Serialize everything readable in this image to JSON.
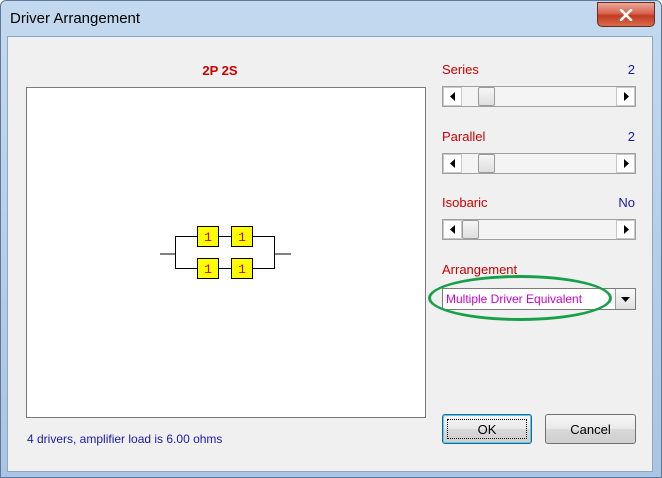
{
  "window": {
    "title": "Driver Arrangement"
  },
  "diagram": {
    "title": "2P 2S",
    "driver_label": "1"
  },
  "status": "4 drivers, amplifier load is 6.00 ohms",
  "series": {
    "label": "Series",
    "value": "2"
  },
  "parallel": {
    "label": "Parallel",
    "value": "2"
  },
  "isobaric": {
    "label": "Isobaric",
    "value": "No"
  },
  "arrangement": {
    "label": "Arrangement",
    "selected": "Multiple Driver Equivalent"
  },
  "buttons": {
    "ok": "OK",
    "cancel": "Cancel"
  },
  "colors": {
    "label_red": "#cc0000",
    "value_blue": "#1a1aa6",
    "combo_magenta": "#cc00cc",
    "highlight_green": "#17a04a",
    "driver_yellow": "#ffff00"
  }
}
